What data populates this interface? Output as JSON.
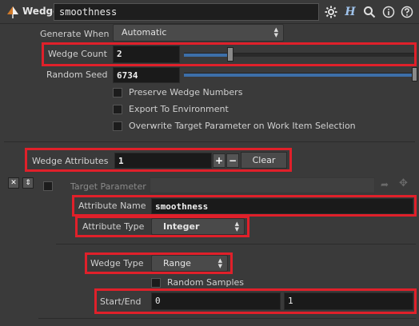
{
  "header": {
    "node_type": "Wedge",
    "node_name": "smoothness",
    "help_letter": "H"
  },
  "params": {
    "generate_when": {
      "label": "Generate When",
      "value": "Automatic"
    },
    "wedge_count": {
      "label": "Wedge Count",
      "value": "2",
      "slider_fraction": 0.2
    },
    "random_seed": {
      "label": "Random Seed",
      "value": "6734",
      "slider_fraction": 1.0
    },
    "preserve_wedge_numbers": {
      "label": "Preserve Wedge Numbers",
      "checked": false
    },
    "export_to_environment": {
      "label": "Export To Environment",
      "checked": false
    },
    "overwrite_target": {
      "label": "Overwrite Target Parameter on Work Item Selection",
      "checked": false
    }
  },
  "wedge_attributes": {
    "label": "Wedge Attributes",
    "count": "1",
    "plus": "+",
    "minus": "−",
    "clear_label": "Clear"
  },
  "attribute": {
    "target_parameter": {
      "label": "Target Parameter",
      "value": ""
    },
    "attribute_name": {
      "label": "Attribute Name",
      "value": "smoothness"
    },
    "attribute_type": {
      "label": "Attribute Type",
      "value": "Integer"
    },
    "wedge_type": {
      "label": "Wedge Type",
      "value": "Range"
    },
    "random_samples": {
      "label": "Random Samples",
      "checked": false
    },
    "start_end": {
      "label": "Start/End",
      "start": "0",
      "end": "1"
    }
  },
  "colors": {
    "highlight": "#e0202a",
    "slider_fill": "#3d6fa8",
    "background": "#3a3a3a"
  }
}
